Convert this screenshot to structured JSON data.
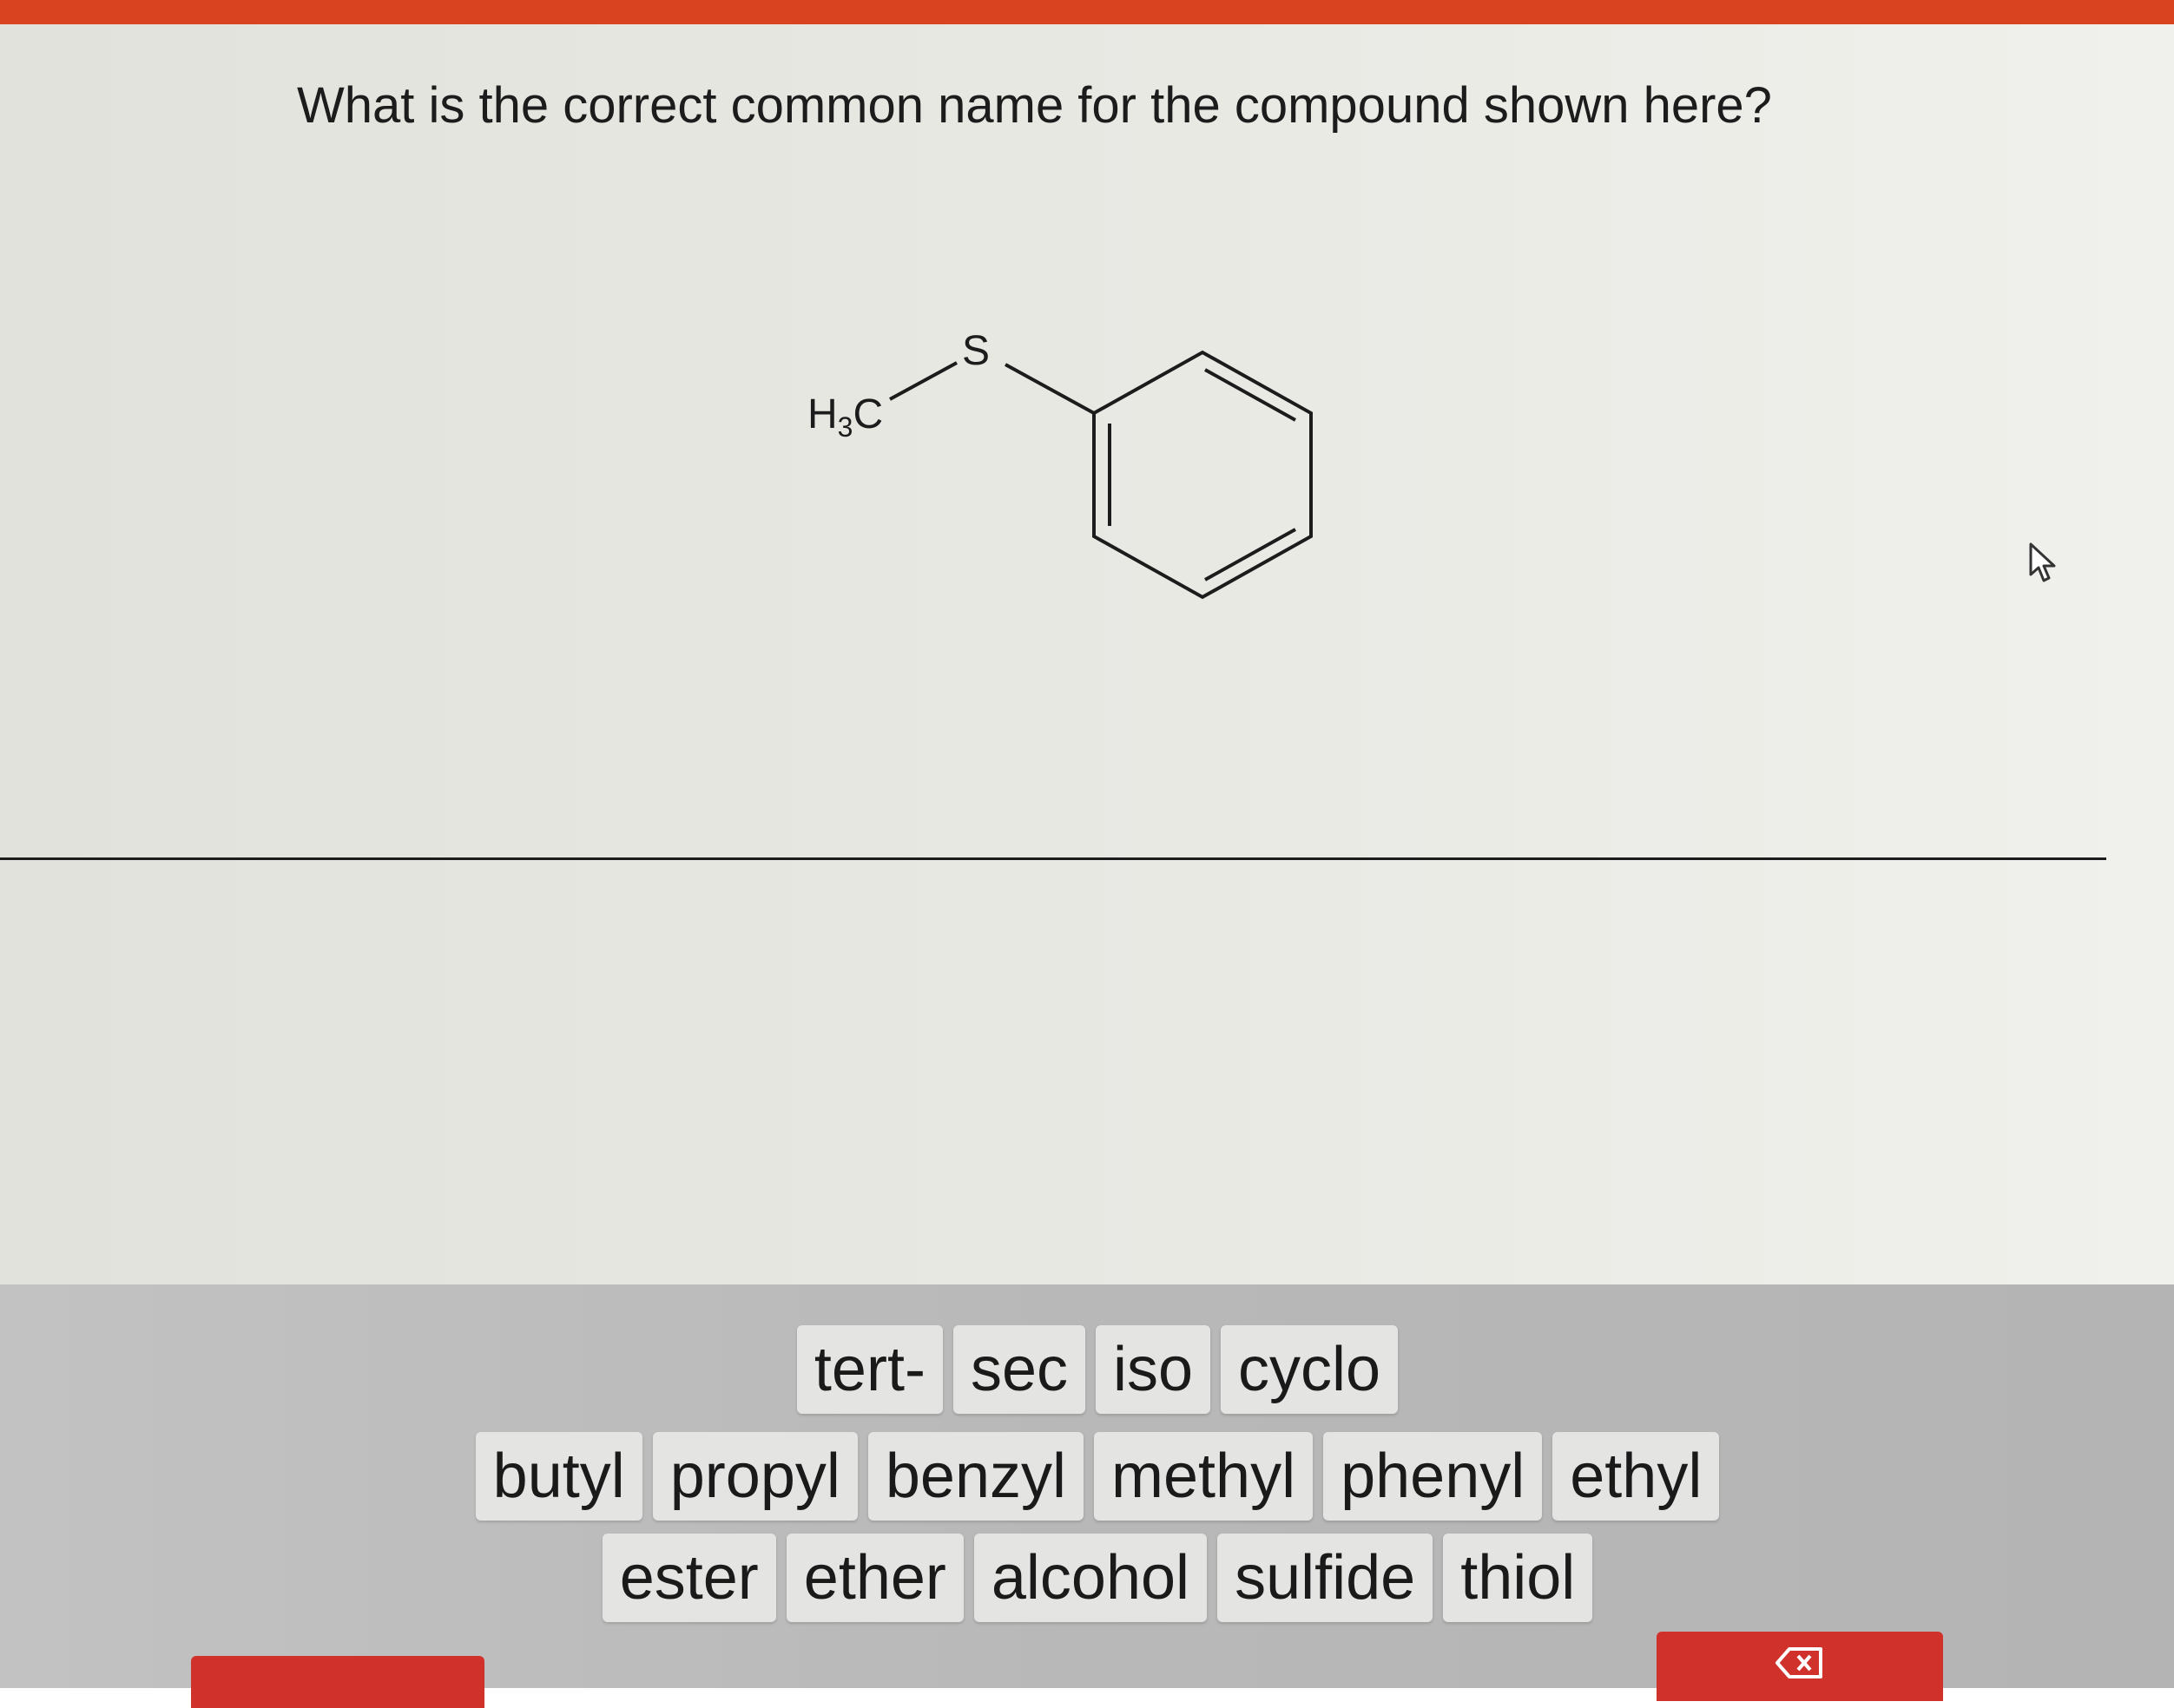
{
  "question": {
    "text": "What is the correct common name for the compound shown here?"
  },
  "structure": {
    "methyl_label": "H",
    "methyl_subscript": "3",
    "methyl_carbon": "C",
    "sulfur_label": "S"
  },
  "tiles": {
    "row1": [
      "tert-",
      "sec",
      "iso",
      "cyclo"
    ],
    "row2": [
      "butyl",
      "propyl",
      "benzyl",
      "methyl",
      "phenyl",
      "ethyl"
    ],
    "row3": [
      "ester",
      "ether",
      "alcohol",
      "sulfide",
      "thiol"
    ]
  },
  "colors": {
    "accent": "#d9431f",
    "button_red": "#d0322b"
  },
  "icons": {
    "cursor": "mouse-pointer-icon",
    "delete": "backspace-icon"
  }
}
